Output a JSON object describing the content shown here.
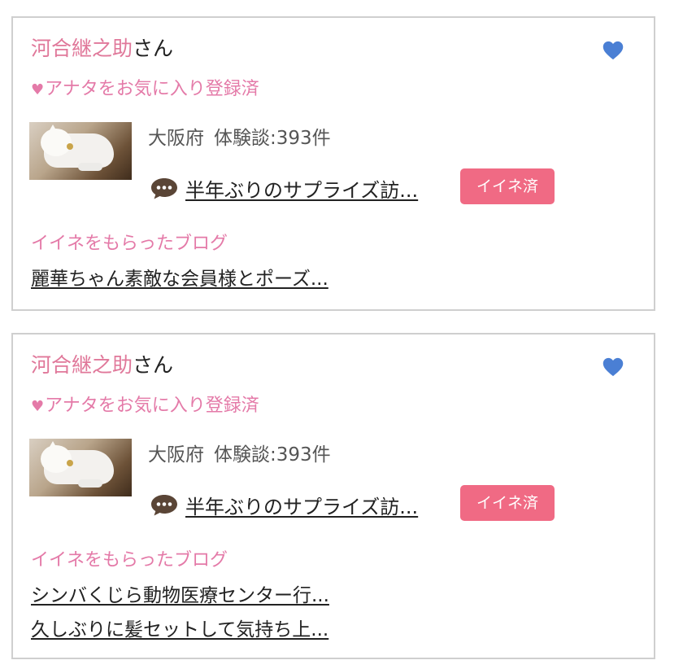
{
  "colors": {
    "accent_pink": "#e47aa8",
    "button_pink": "#f06a84",
    "heart_blue": "#4a7fd4"
  },
  "cards": [
    {
      "user_name": "河合継之助",
      "suffix": "さん",
      "favorite_icon": "heart-icon",
      "fav_status": "アナタをお気に入り登録済",
      "location": "大阪府",
      "experience_count": "体験談:393件",
      "blog_title": "半年ぶりのサプライズ訪...",
      "iine_button": "イイネ済",
      "received_title": "イイネをもらったブログ",
      "received_blogs": [
        "麗華ちゃん素敵な会員様とポーズ..."
      ]
    },
    {
      "user_name": "河合継之助",
      "suffix": "さん",
      "favorite_icon": "heart-icon",
      "fav_status": "アナタをお気に入り登録済",
      "location": "大阪府",
      "experience_count": "体験談:393件",
      "blog_title": "半年ぶりのサプライズ訪...",
      "iine_button": "イイネ済",
      "received_title": "イイネをもらったブログ",
      "received_blogs": [
        "シンバくじら動物医療センター行...",
        "久しぶりに髪セットして気持ち上..."
      ]
    }
  ]
}
